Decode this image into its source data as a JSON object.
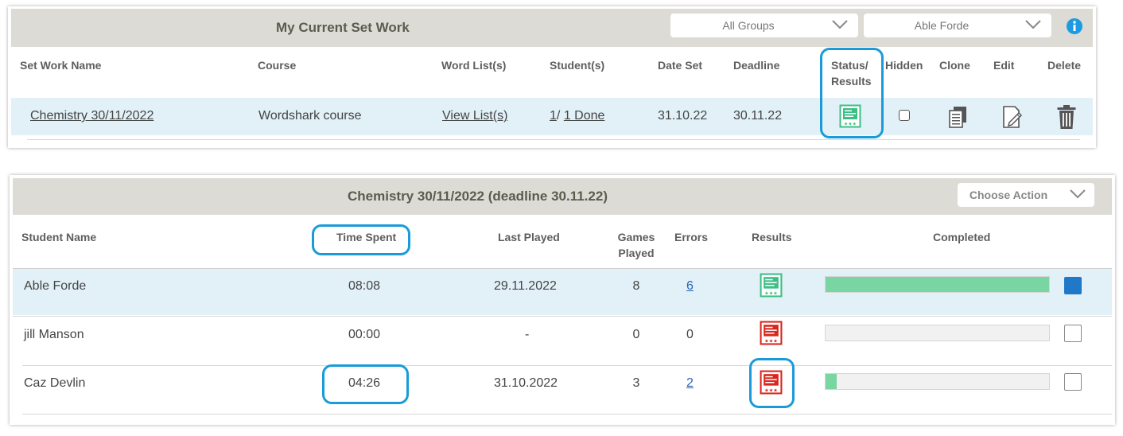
{
  "set_work": {
    "title": "My Current Set Work",
    "groups_dropdown": "All Groups",
    "student_dropdown": "Able Forde",
    "columns": {
      "name": "Set Work Name",
      "course": "Course",
      "word_lists": "Word List(s)",
      "students": "Student(s)",
      "date_set": "Date Set",
      "deadline": "Deadline",
      "status_line1": "Status/",
      "status_line2": "Results",
      "hidden": "Hidden",
      "clone": "Clone",
      "edit": "Edit",
      "delete": "Delete"
    },
    "row": {
      "name": "Chemistry 30/11/2022",
      "course": "Wordshark course",
      "word_lists": "View List(s)",
      "students_count": "1",
      "students_sep": "/",
      "students_done": "1 Done",
      "date_set": "31.10.22",
      "deadline": "30.11.22",
      "status": "green",
      "hidden": false
    }
  },
  "detail": {
    "title": "Chemistry 30/11/2022 (deadline 30.11.22)",
    "action_dropdown": "Choose Action",
    "columns": {
      "student": "Student Name",
      "time": "Time Spent",
      "last_played": "Last Played",
      "games_line1": "Games",
      "games_line2": "Played",
      "errors": "Errors",
      "results": "Results",
      "completed": "Completed"
    },
    "rows": [
      {
        "student": "Able Forde",
        "time": "08:08",
        "last_played": "29.11.2022",
        "games": "8",
        "errors": "6",
        "errors_link": true,
        "result": "green",
        "completed": 1.0,
        "checked": true
      },
      {
        "student": "jill Manson",
        "time": "00:00",
        "last_played": "-",
        "games": "0",
        "errors": "0",
        "errors_link": false,
        "result": "red",
        "completed": 0.0,
        "checked": false
      },
      {
        "student": "Caz Devlin",
        "time": "04:26",
        "last_played": "31.10.2022",
        "games": "3",
        "errors": "2",
        "errors_link": true,
        "result": "red",
        "completed": 0.05,
        "checked": false
      }
    ]
  },
  "colors": {
    "accent": "#1a9bd8",
    "header_bg": "#dcdbd5",
    "row_highlight": "#e2f0f8",
    "progress_fill": "#79d5a2",
    "result_green": "#3cbf84",
    "result_red": "#d9261c",
    "checkbox_on": "#1f79c8"
  }
}
